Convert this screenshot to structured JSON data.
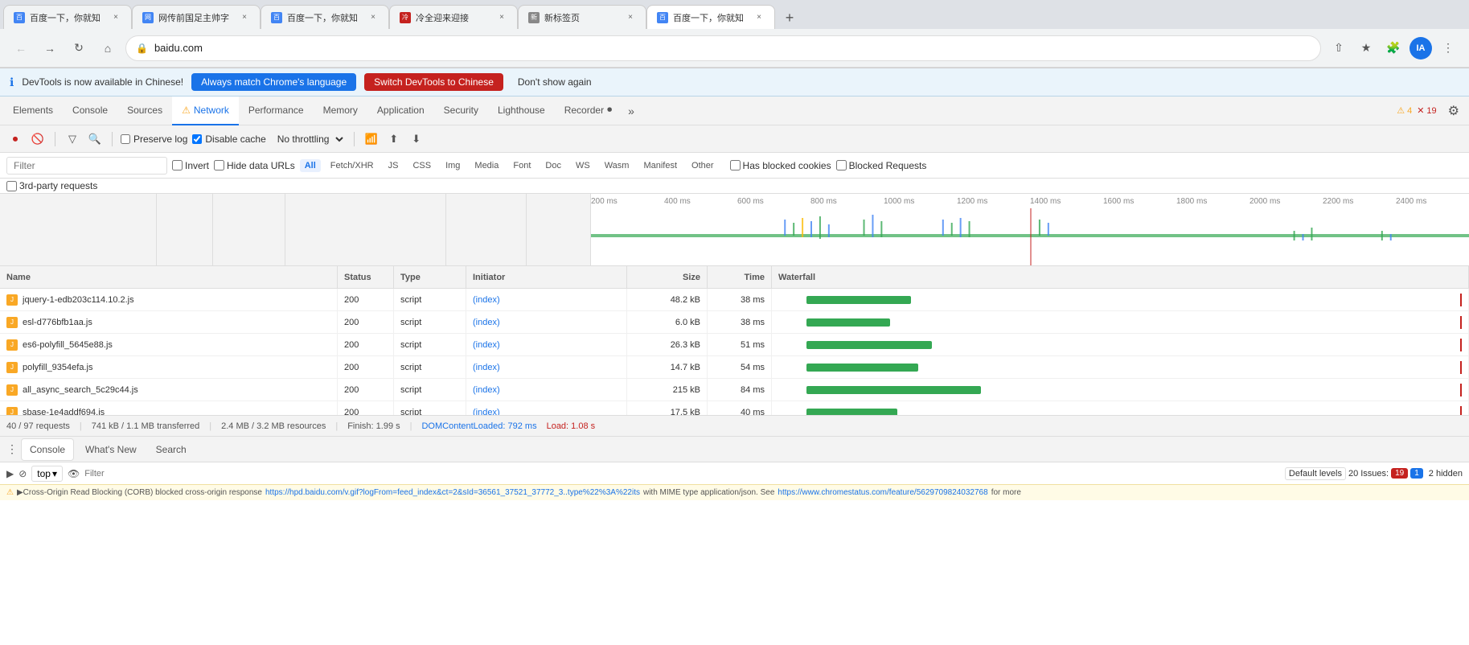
{
  "browser": {
    "tabs": [
      {
        "id": 1,
        "title": "百度一下，你就知",
        "favicon_color": "#4285f4",
        "active": false
      },
      {
        "id": 2,
        "title": "网传前国足主帅字",
        "favicon_color": "#4285f4",
        "active": false
      },
      {
        "id": 3,
        "title": "百度一下，你就知",
        "favicon_color": "#4285f4",
        "active": false
      },
      {
        "id": 4,
        "title": "冷全迎来迎接",
        "favicon_color": "#c5221f",
        "active": false
      },
      {
        "id": 5,
        "title": "新标签页",
        "favicon_color": "#4285f4",
        "active": false
      },
      {
        "id": 6,
        "title": "百度一下，你就知",
        "favicon_color": "#4285f4",
        "active": true
      }
    ],
    "url": "baidu.com",
    "new_tab_icon": "+"
  },
  "info_bar": {
    "message": "DevTools is now available in Chinese!",
    "btn1_label": "Always match Chrome's language",
    "btn2_label": "Switch DevTools to Chinese",
    "btn3_label": "Don't show again"
  },
  "devtools_tabs": {
    "tabs": [
      {
        "id": "elements",
        "label": "Elements",
        "active": false
      },
      {
        "id": "console",
        "label": "Console",
        "active": false
      },
      {
        "id": "sources",
        "label": "Sources",
        "active": false
      },
      {
        "id": "network",
        "label": "Network",
        "active": true,
        "warn": true
      },
      {
        "id": "performance",
        "label": "Performance",
        "active": false
      },
      {
        "id": "memory",
        "label": "Memory",
        "active": false
      },
      {
        "id": "application",
        "label": "Application",
        "active": false
      },
      {
        "id": "security",
        "label": "Security",
        "active": false
      },
      {
        "id": "lighthouse",
        "label": "Lighthouse",
        "active": false
      },
      {
        "id": "recorder",
        "label": "Recorder",
        "active": false
      }
    ],
    "warn_count": 4,
    "err_count": 19
  },
  "toolbar": {
    "preserve_log_label": "Preserve log",
    "disable_cache_label": "Disable cache",
    "throttle_label": "No throttling"
  },
  "filter_bar": {
    "filter_placeholder": "Filter",
    "invert_label": "Invert",
    "hide_data_urls_label": "Hide data URLs",
    "types": [
      "All",
      "Fetch/XHR",
      "JS",
      "CSS",
      "Img",
      "Media",
      "Font",
      "Doc",
      "WS",
      "Wasm",
      "Manifest",
      "Other"
    ],
    "active_type": "All",
    "has_blocked_cookies_label": "Has blocked cookies",
    "blocked_requests_label": "Blocked Requests",
    "third_party_label": "3rd-party requests"
  },
  "timeline": {
    "ticks": [
      "200 ms",
      "400 ms",
      "600 ms",
      "800 ms",
      "1000 ms",
      "1200 ms",
      "1400 ms",
      "1600 ms",
      "1800 ms",
      "2000 ms",
      "2200 ms",
      "2400 ms"
    ]
  },
  "table": {
    "headers": [
      "Name",
      "Status",
      "Type",
      "Initiator",
      "Size",
      "Time",
      "Waterfall"
    ],
    "rows": [
      {
        "name": "jquery-1-edb203c114.10.2.js",
        "status": "200",
        "type": "script",
        "initiator": "(index)",
        "size": "48.2 kB",
        "time": "38 ms"
      },
      {
        "name": "esl-d776bfb1aa.js",
        "status": "200",
        "type": "script",
        "initiator": "(index)",
        "size": "6.0 kB",
        "time": "38 ms"
      },
      {
        "name": "es6-polyfill_5645e88.js",
        "status": "200",
        "type": "script",
        "initiator": "(index)",
        "size": "26.3 kB",
        "time": "51 ms"
      },
      {
        "name": "polyfill_9354efa.js",
        "status": "200",
        "type": "script",
        "initiator": "(index)",
        "size": "14.7 kB",
        "time": "54 ms"
      },
      {
        "name": "all_async_search_5c29c44.js",
        "status": "200",
        "type": "script",
        "initiator": "(index)",
        "size": "215 kB",
        "time": "84 ms"
      },
      {
        "name": "sbase-1e4addf694.js",
        "status": "200",
        "type": "script",
        "initiator": "(index)",
        "size": "17.5 kB",
        "time": "40 ms"
      }
    ]
  },
  "status_bar": {
    "requests": "40 / 97 requests",
    "transferred": "741 kB / 1.1 MB transferred",
    "resources": "2.4 MB / 3.2 MB resources",
    "finish": "Finish: 1.99 s",
    "dom_content": "DOMContentLoaded: 792 ms",
    "load": "Load: 1.08 s"
  },
  "bottom_tabs": {
    "tabs": [
      {
        "id": "console",
        "label": "Console",
        "active": true
      },
      {
        "id": "whats-new",
        "label": "What's New",
        "active": false
      },
      {
        "id": "search",
        "label": "Search",
        "active": false
      }
    ]
  },
  "console_bar": {
    "context": "top",
    "filter_placeholder": "Filter",
    "default_levels_label": "Default levels",
    "issues_label": "20 Issues:",
    "err_count": "19",
    "warn_count": "1",
    "hidden_count": "2 hidden"
  },
  "console_msg": {
    "warning": "▶Cross-Origin Read Blocking (CORB) blocked cross-origin response",
    "link1": "https://hpd.baidu.com/v.gif?logFrom=feed_index&ct=2&sId=36561_37521_37772_3..type%22%3A%22its",
    "middle": "with MIME type application/json. See",
    "link2": "https://www.chromestatus.com/feature/5629709824032768",
    "suffix": "for more"
  }
}
